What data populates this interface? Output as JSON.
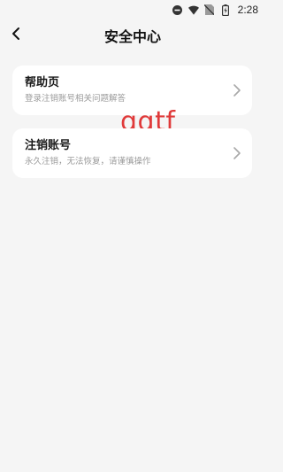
{
  "status_bar": {
    "time": "2:28",
    "icons": [
      "do-not-disturb-icon",
      "wifi-icon",
      "no-sim-icon",
      "battery-charging-icon"
    ]
  },
  "header": {
    "title": "安全中心",
    "back_icon": "back-arrow-icon"
  },
  "items": [
    {
      "title": "帮助页",
      "subtitle": "登录注销账号相关问题解答",
      "icon": "chevron-right-icon"
    },
    {
      "title": "注销账号",
      "subtitle": "永久注销，无法恢复，请谨慎操作",
      "icon": "chevron-right-icon"
    }
  ],
  "watermark": "qqtf",
  "colors": {
    "background": "#f5f5f5",
    "card": "#ffffff",
    "watermark": "#e03a3a",
    "subtitle": "#9a9a9a"
  }
}
